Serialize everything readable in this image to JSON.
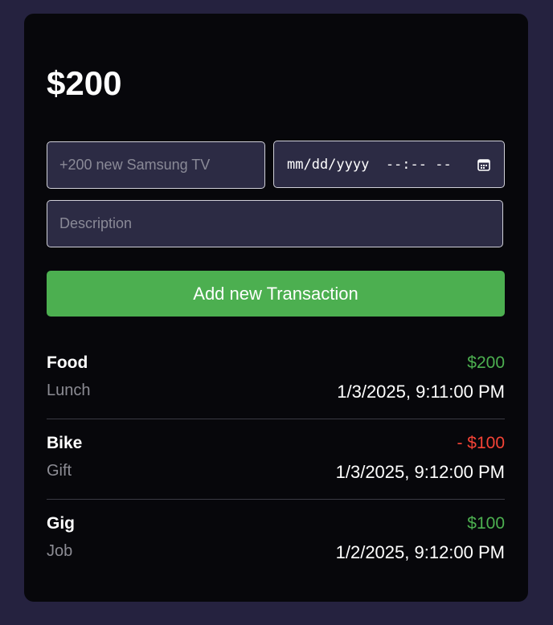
{
  "balance": "$200",
  "form": {
    "name_placeholder": "+200 new Samsung TV",
    "datetime_display": "mm/dd/yyyy  --:-- --",
    "description_placeholder": "Description",
    "submit_label": "Add new Transaction"
  },
  "transactions": [
    {
      "name": "Food",
      "description": "Lunch",
      "amount": "$200",
      "type": "income",
      "datetime": "1/3/2025, 9:11:00 PM"
    },
    {
      "name": "Bike",
      "description": "Gift",
      "amount": "- $100",
      "type": "expense",
      "datetime": "1/3/2025, 9:12:00 PM"
    },
    {
      "name": "Gig",
      "description": "Job",
      "amount": "$100",
      "type": "income",
      "datetime": "1/2/2025, 9:12:00 PM"
    }
  ],
  "colors": {
    "background": "#25223f",
    "card": "#07070b",
    "income": "#4caf50",
    "expense": "#f44336",
    "button": "#4caf50"
  },
  "icons": {
    "date_picker": "calendar-icon"
  }
}
